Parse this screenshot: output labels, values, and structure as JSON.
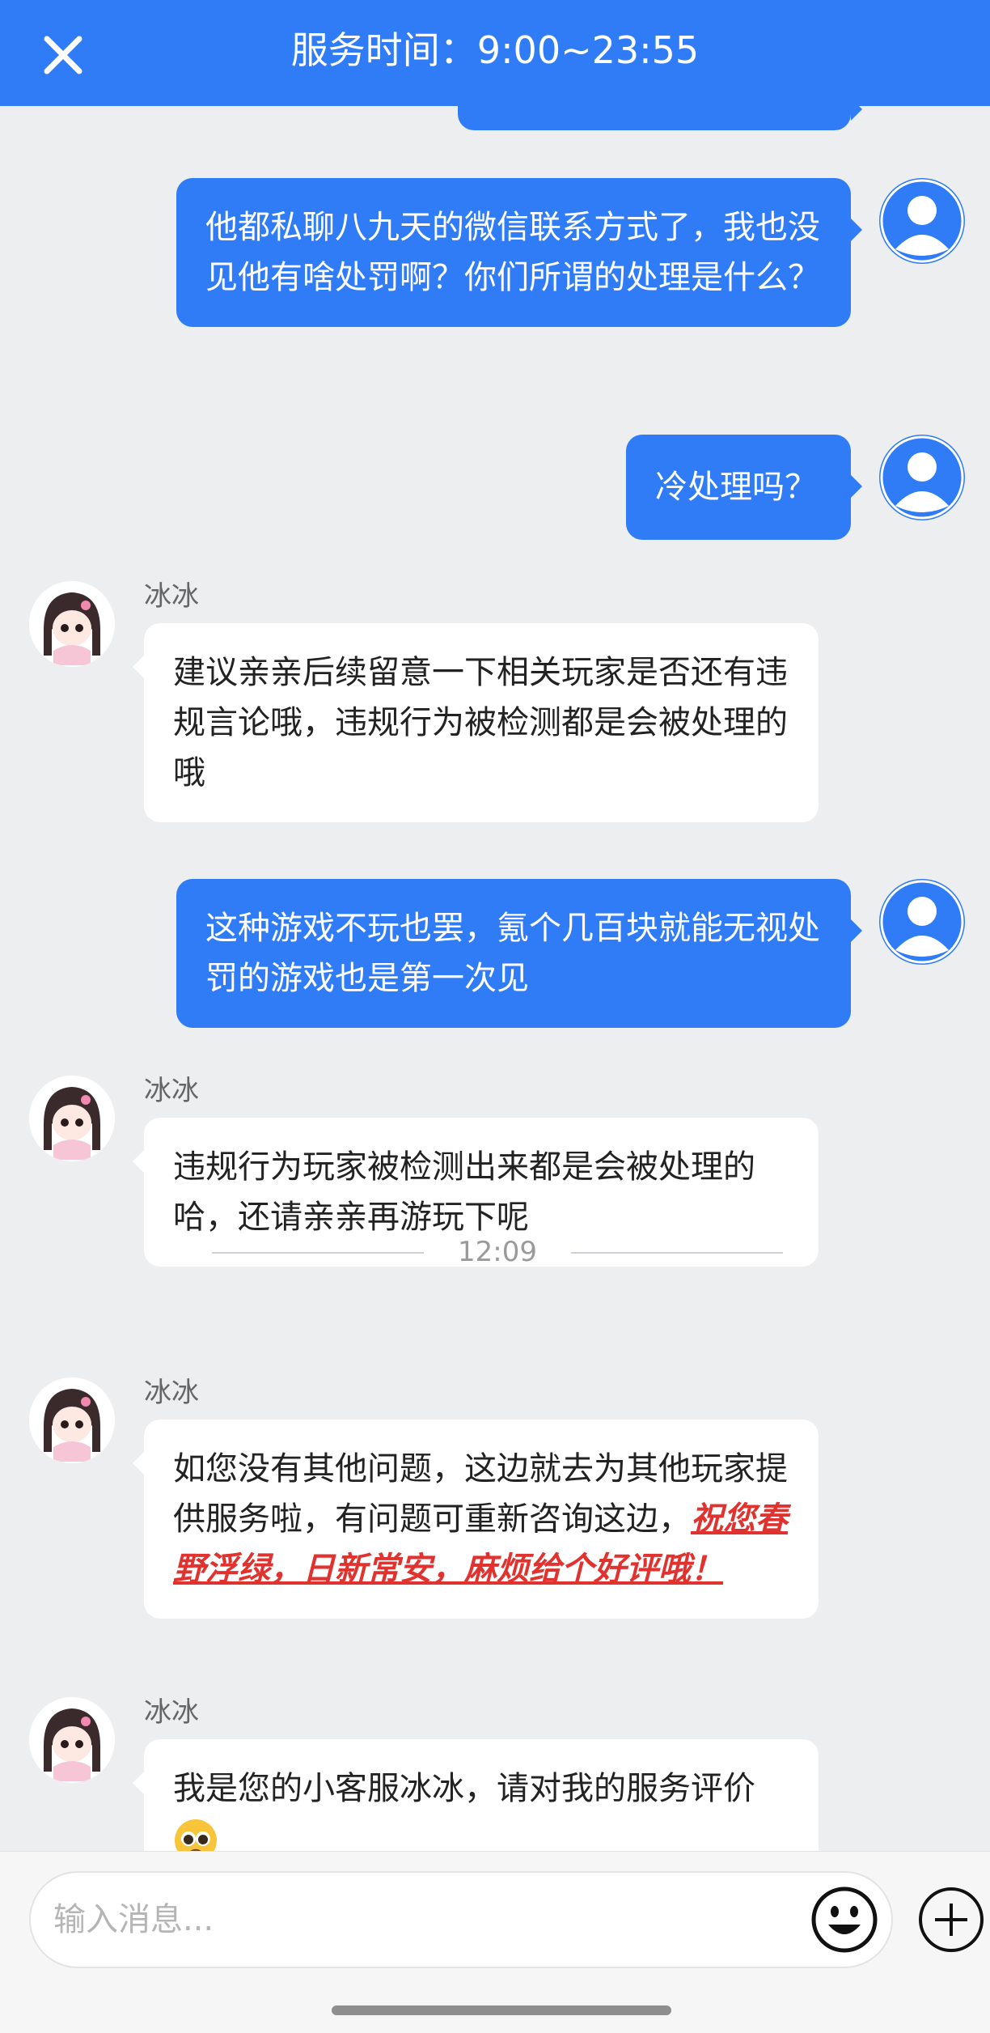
{
  "header": {
    "title": "服务时间：9:00~23:55",
    "close_icon": "close-icon"
  },
  "messages": [
    {
      "sender": "user",
      "text": "他都私聊八九天的微信联系方式了，我也没见他有啥处罚啊？你们所谓的处理是什么？"
    },
    {
      "sender": "user",
      "text": "冷处理吗？"
    },
    {
      "sender": "agent",
      "name": "冰冰",
      "text": "建议亲亲后续留意一下相关玩家是否还有违规言论哦，违规行为被检测都是会被处理的哦"
    },
    {
      "sender": "user",
      "text": "这种游戏不玩也罢，氪个几百块就能无视处罚的游戏也是第一次见"
    },
    {
      "sender": "agent",
      "name": "冰冰",
      "text": "违规行为玩家被检测出来都是会被处理的哈，还请亲亲再游玩下呢"
    },
    {
      "sender": "agent",
      "name": "冰冰",
      "text": "如您没有其他问题，这边就去为其他玩家提供服务啦，有问题可重新咨询这边，",
      "highlight": "祝您春野浮绿，日新常安，麻烦给个好评哦！"
    },
    {
      "sender": "agent",
      "name": "冰冰",
      "text": "我是您的小客服冰冰，请对我的服务评价",
      "emoji": "pleading-face-emoji"
    }
  ],
  "time_divider": "12:09",
  "composer": {
    "placeholder": "输入消息...",
    "emoji_icon": "smiley-icon",
    "plus_icon": "plus-icon"
  },
  "colors": {
    "accent": "#2f7cf6",
    "background": "#edeef0",
    "highlight": "#e0322f"
  }
}
